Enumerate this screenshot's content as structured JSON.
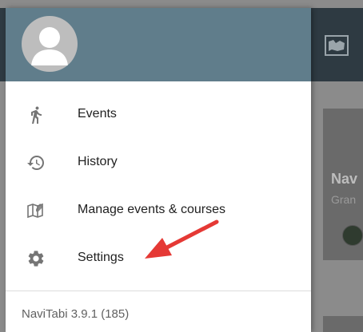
{
  "menu": {
    "items": [
      {
        "label": "Events",
        "icon": "running-person-icon"
      },
      {
        "label": "History",
        "icon": "history-icon"
      },
      {
        "label": "Manage events & courses",
        "icon": "map-edit-icon"
      },
      {
        "label": "Settings",
        "icon": "gear-icon"
      }
    ]
  },
  "footer": {
    "version": "NaviTabi 3.9.1 (185)"
  },
  "background": {
    "card_title": "Nav",
    "card_subtitle": "Gran"
  },
  "colors": {
    "header": "#607d8b",
    "icon": "#757575",
    "arrow": "#e53935"
  }
}
